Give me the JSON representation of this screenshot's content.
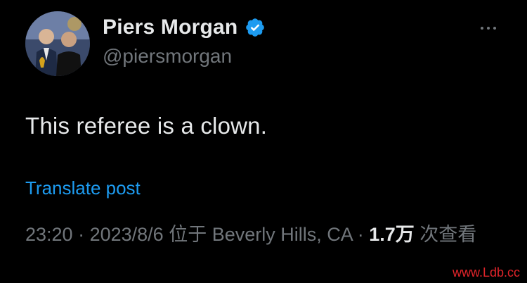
{
  "author": {
    "display_name": "Piers Morgan",
    "handle": "@piersmorgan",
    "verified_icon": "verified-badge-icon",
    "avatar": "avatar-photo"
  },
  "tweet": {
    "text": "This referee is a clown.",
    "translate_label": "Translate post"
  },
  "meta": {
    "time": "23:20",
    "sep1": " · ",
    "date": "2023/8/6",
    "location": " 位于 Beverly Hills, CA",
    "sep2": " · ",
    "views_count": "1.7万",
    "views_label": " 次查看"
  },
  "watermark": "www.Ldb.cc",
  "colors": {
    "background": "#000000",
    "primary_text": "#e7e9ea",
    "secondary_text": "#71767b",
    "link": "#1d9bf0",
    "verified": "#1d9bf0",
    "watermark": "#e0242a"
  },
  "icons": {
    "more": "more-horizontal-icon"
  }
}
